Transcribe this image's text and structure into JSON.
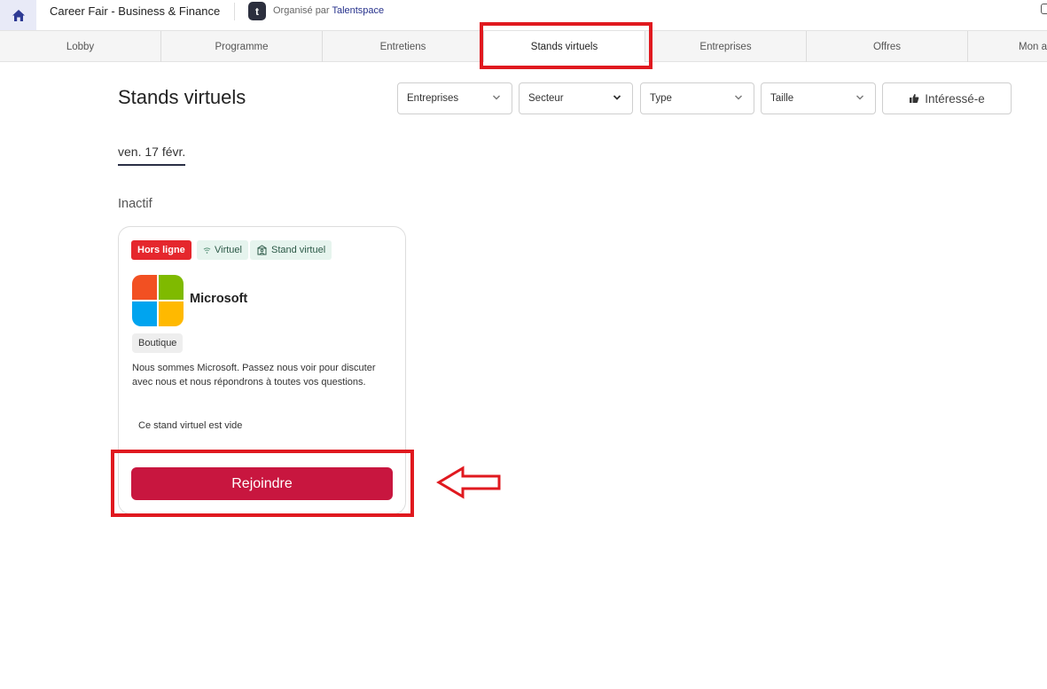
{
  "header": {
    "event_title": "Career Fair - Business & Finance",
    "org_prefix": "Organisé par",
    "org_name": "Talentspace",
    "org_logo_letter": "t"
  },
  "tabs": [
    {
      "label": "Lobby",
      "active": false
    },
    {
      "label": "Programme",
      "active": false
    },
    {
      "label": "Entretiens",
      "active": false
    },
    {
      "label": "Stands virtuels",
      "active": true
    },
    {
      "label": "Entreprises",
      "active": false
    },
    {
      "label": "Offres",
      "active": false
    },
    {
      "label": "Mon a",
      "active": false
    }
  ],
  "main": {
    "title": "Stands virtuels",
    "filters": {
      "companies": "Entreprises",
      "sector": "Secteur",
      "type": "Type",
      "size": "Taille",
      "interested": "Intéressé-e"
    },
    "date_tab": "ven. 17 févr.",
    "section_label": "Inactif"
  },
  "card": {
    "status_badge": "Hors ligne",
    "virtual_badge": "Virtuel",
    "stand_badge": "Stand virtuel",
    "company_name": "Microsoft",
    "tag": "Boutique",
    "description": "Nous sommes Microsoft. Passez nous voir pour discuter avec nous et nous répondrons à toutes vos questions.",
    "empty_note": "Ce stand virtuel est vide",
    "join_label": "Rejoindre"
  },
  "colors": {
    "accent": "#c8163f",
    "offline_badge": "#e5272d",
    "annotation": "#e0191f",
    "ms_red": "#f25022",
    "ms_green": "#7fba00",
    "ms_blue": "#00a4ef",
    "ms_yellow": "#ffb900"
  },
  "icons": {
    "home": "home-icon",
    "chevron": "chevron-down-icon",
    "thumb": "thumbs-up-icon",
    "wifi": "wifi-icon",
    "stand": "stand-icon",
    "arrow": "arrow-left-icon"
  }
}
